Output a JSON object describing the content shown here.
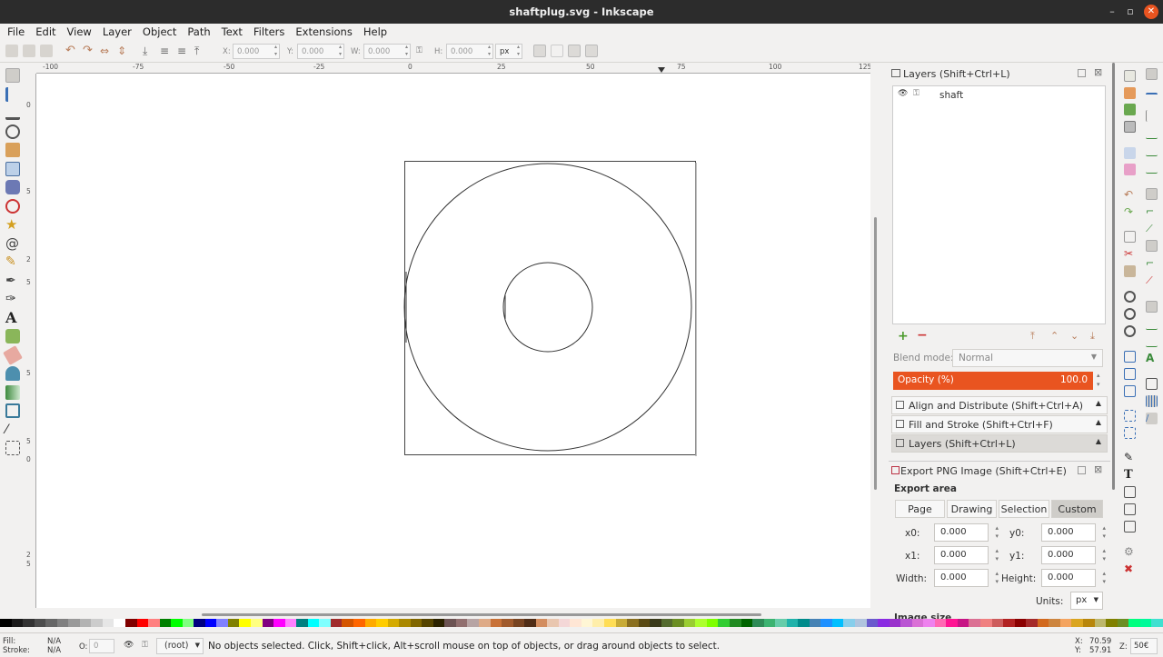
{
  "window": {
    "title": "shaftplug.svg - Inkscape",
    "minimize": "–",
    "maximize": "▫",
    "close": "✕"
  },
  "menu": [
    "File",
    "Edit",
    "View",
    "Layer",
    "Object",
    "Path",
    "Text",
    "Filters",
    "Extensions",
    "Help"
  ],
  "controls": {
    "x_label": "X:",
    "x_value": "0.000",
    "y_label": "Y:",
    "y_value": "0.000",
    "w_label": "W:",
    "w_value": "0.000",
    "h_label": "H:",
    "h_value": "0.000",
    "unit": "px"
  },
  "ruler": {
    "top_labels": [
      "-100",
      "-75",
      "-50",
      "-25",
      "0",
      "25",
      "50",
      "75",
      "100",
      "125"
    ],
    "left_labels": [
      "0",
      "5",
      "2",
      "5",
      "5",
      "5",
      "0",
      "2",
      "5"
    ]
  },
  "layers_panel": {
    "title": "Layers (Shift+Ctrl+L)",
    "layers": [
      {
        "name": "shaft"
      }
    ],
    "blend_label": "Blend mode:",
    "blend_value": "Normal",
    "opacity_label": "Opacity (%)",
    "opacity_value": "100.0",
    "opacity_fraction": 1.0
  },
  "collapsed_panels": [
    "Align and Distribute (Shift+Ctrl+A)",
    "Fill and Stroke (Shift+Ctrl+F)",
    "Layers (Shift+Ctrl+L)"
  ],
  "export_panel": {
    "title": "Export PNG Image (Shift+Ctrl+E)",
    "section": "Export area",
    "tabs": [
      "Page",
      "Drawing",
      "Selection",
      "Custom"
    ],
    "active_tab": "Custom",
    "x0_label": "x0:",
    "x0": "0.000",
    "y0_label": "y0:",
    "y0": "0.000",
    "x1_label": "x1:",
    "x1": "0.000",
    "y1_label": "y1:",
    "y1": "0.000",
    "width_label": "Width:",
    "width": "0.000",
    "height_label": "Height:",
    "height": "0.000",
    "units_label": "Units:",
    "units": "px",
    "image_size_label": "Image size"
  },
  "status": {
    "fill_label": "Fill:",
    "fill_value": "N/A",
    "stroke_label": "Stroke:",
    "stroke_value": "N/A",
    "opacity_label": "O:",
    "opacity_value": "0",
    "layer": "(root)",
    "message": "No objects selected. Click, Shift+click, Alt+scroll mouse on top of objects, or drag around objects to select.",
    "x_label": "X:",
    "x": "70.59",
    "y_label": "Y:",
    "y": "57.91",
    "z_label": "Z:",
    "zoom": "50€"
  },
  "colors": {
    "accent": "#e95420",
    "titlebar": "#2c2c2c"
  }
}
